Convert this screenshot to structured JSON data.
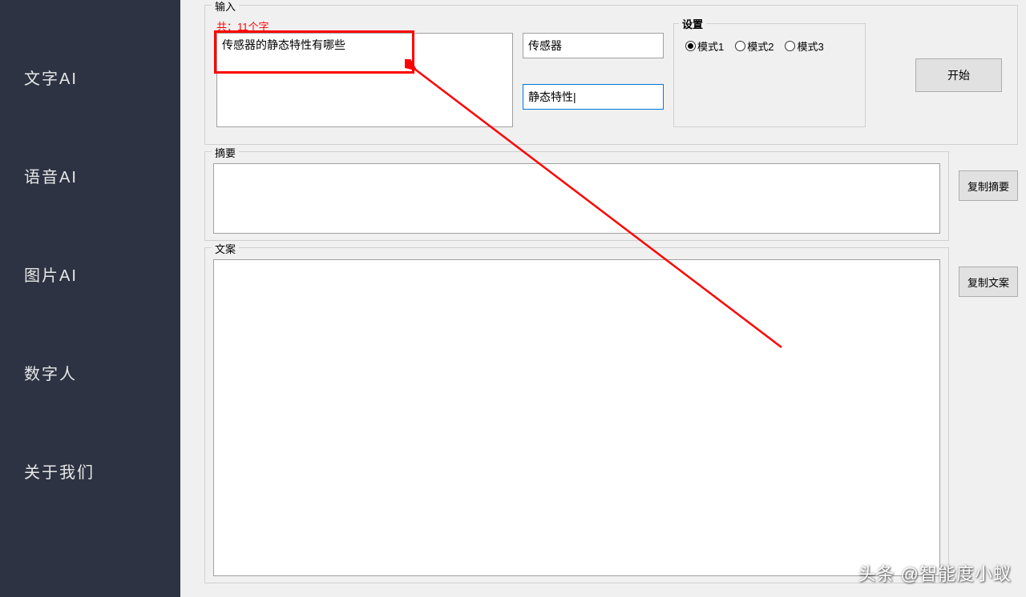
{
  "sidebar": {
    "items": [
      {
        "label": "文字AI"
      },
      {
        "label": "语音AI"
      },
      {
        "label": "图片AI"
      },
      {
        "label": "数字人"
      },
      {
        "label": "关于我们"
      }
    ]
  },
  "input_section": {
    "title": "输入",
    "count_text": "共：11个字",
    "main_text": "传感器的静态特性有哪些",
    "field1": "传感器",
    "field2": "静态特性|"
  },
  "settings": {
    "title": "设置",
    "modes": [
      {
        "label": "模式1",
        "checked": true
      },
      {
        "label": "模式2",
        "checked": false
      },
      {
        "label": "模式3",
        "checked": false
      }
    ]
  },
  "buttons": {
    "start": "开始",
    "copy_summary": "复制摘要",
    "copy_content": "复制文案"
  },
  "summary": {
    "title": "摘要",
    "value": ""
  },
  "content": {
    "title": "文案",
    "value": ""
  },
  "watermark": "头条 @智能度小蚁"
}
